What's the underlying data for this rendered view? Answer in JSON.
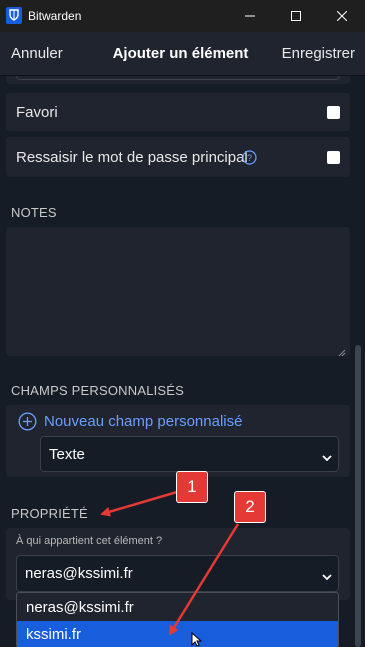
{
  "window": {
    "title": "Bitwarden"
  },
  "header": {
    "cancel": "Annuler",
    "title": "Ajouter un élément",
    "save": "Enregistrer"
  },
  "options": {
    "favorite_label": "Favori",
    "reprompt_label": "Ressaisir le mot de passe principal"
  },
  "notes": {
    "section_title": "NOTES",
    "value": ""
  },
  "custom_fields": {
    "section_title": "CHAMPS PERSONNALISÉS",
    "new_field_label": "Nouveau champ personnalisé",
    "type_selected": "Texte"
  },
  "ownership": {
    "section_title": "PROPRIÉTÉ",
    "question": "À qui appartient cet élément ?",
    "selected": "neras@kssimi.fr",
    "dropdown_options": [
      "neras@kssimi.fr",
      "kssimi.fr"
    ],
    "highlighted_index": 1
  },
  "annotations": {
    "callout_1": "1",
    "callout_2": "2"
  },
  "colors": {
    "accent": "#175ddc",
    "callout": "#e53935",
    "panel": "#1f242e",
    "background": "#161c26",
    "link": "#6b9eff"
  },
  "icons": [
    "bitwarden-logo-icon",
    "minimize-icon",
    "maximize-icon",
    "close-icon",
    "help-circle-icon",
    "plus-circle-icon",
    "chevron-down-icon",
    "mouse-cursor-icon"
  ]
}
